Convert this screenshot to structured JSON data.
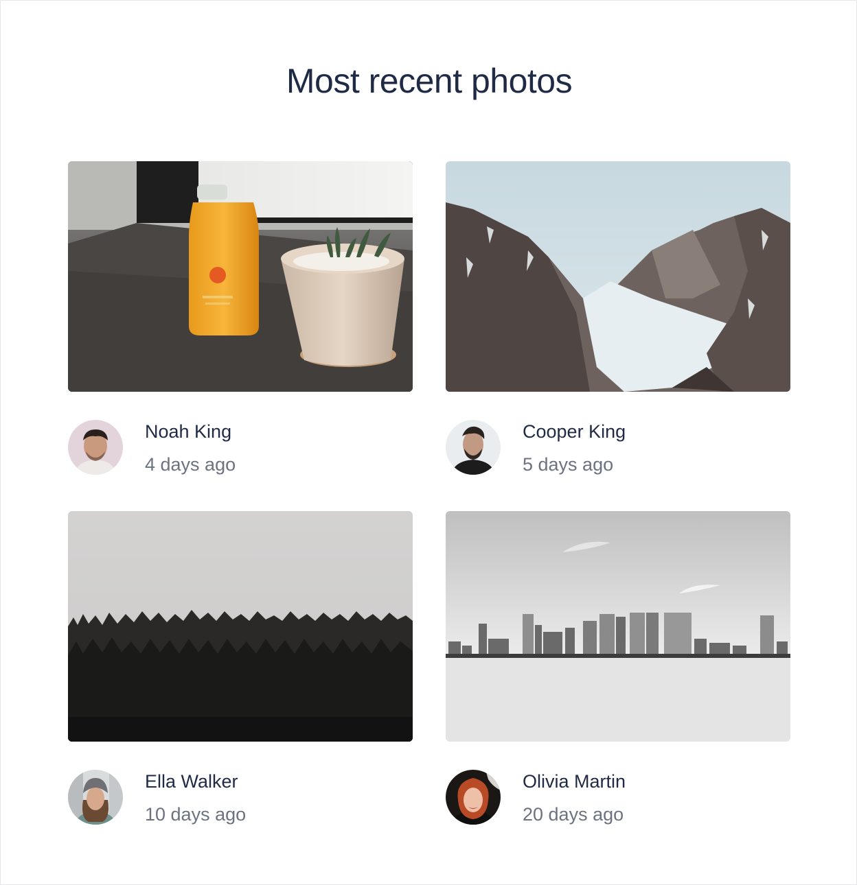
{
  "page": {
    "title": "Most recent photos"
  },
  "photos": [
    {
      "author": "Noah King",
      "time": "4 days ago",
      "image": "juice-bottle-and-succulent-photo"
    },
    {
      "author": "Cooper King",
      "time": "5 days ago",
      "image": "snowy-mountains-photo"
    },
    {
      "author": "Ella Walker",
      "time": "10 days ago",
      "image": "foggy-forest-photo"
    },
    {
      "author": "Olivia Martin",
      "time": "20 days ago",
      "image": "city-skyline-photo"
    }
  ]
}
